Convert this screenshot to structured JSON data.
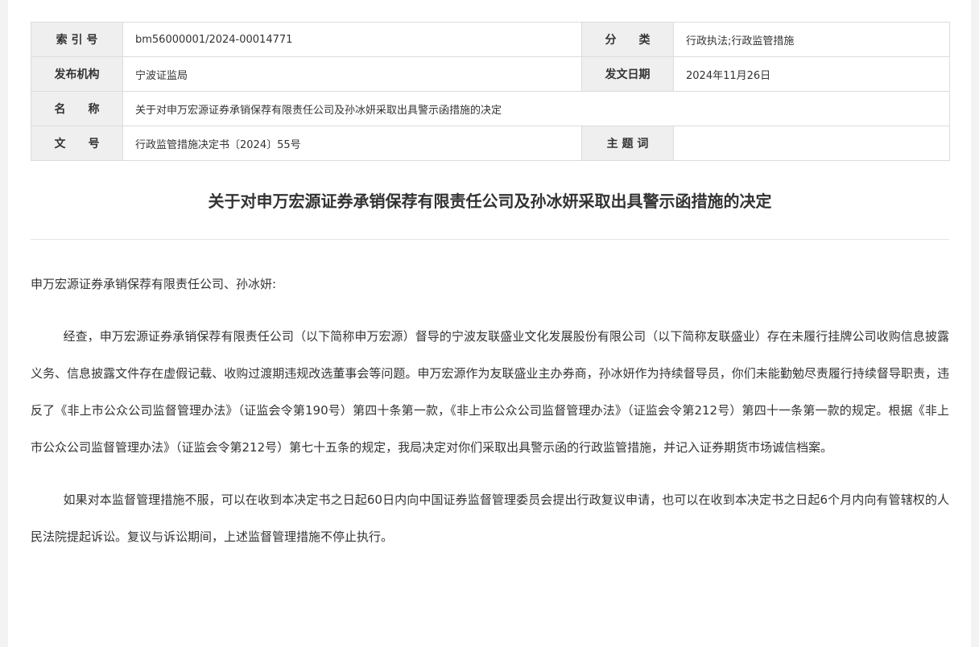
{
  "meta": {
    "index_label": "索 引 号",
    "index_value": "bm56000001/2024-00014771",
    "category_label": "分　　类",
    "category_value": "行政执法;行政监管措施",
    "issuer_label": "发布机构",
    "issuer_value": "宁波证监局",
    "date_label": "发文日期",
    "date_value": "2024年11月26日",
    "name_label": "名　　称",
    "name_value": "关于对申万宏源证券承销保荐有限责任公司及孙冰妍采取出具警示函措施的决定",
    "docno_label": "文　　号",
    "docno_value": "行政监管措施决定书〔2024〕55号",
    "subject_label": "主 题 词",
    "subject_value": ""
  },
  "document": {
    "title": "关于对申万宏源证券承销保荐有限责任公司及孙冰妍采取出具警示函措施的决定",
    "addressee": "申万宏源证券承销保荐有限责任公司、孙冰妍:",
    "paragraph_1": "经查，申万宏源证券承销保荐有限责任公司（以下简称申万宏源）督导的宁波友联盛业文化发展股份有限公司（以下简称友联盛业）存在未履行挂牌公司收购信息披露义务、信息披露文件存在虚假记载、收购过渡期违规改选董事会等问题。申万宏源作为友联盛业主办券商，孙冰妍作为持续督导员，你们未能勤勉尽责履行持续督导职责，违反了《非上市公众公司监督管理办法》（证监会令第190号）第四十条第一款，《非上市公众公司监督管理办法》（证监会令第212号）第四十一条第一款的规定。根据《非上市公众公司监督管理办法》（证监会令第212号）第七十五条的规定，我局决定对你们采取出具警示函的行政监管措施，并记入证券期货市场诚信档案。",
    "paragraph_2": "如果对本监督管理措施不服，可以在收到本决定书之日起60日内向中国证券监督管理委员会提出行政复议申请，也可以在收到本决定书之日起6个月内向有管辖权的人民法院提起诉讼。复议与诉讼期间，上述监督管理措施不停止执行。"
  }
}
